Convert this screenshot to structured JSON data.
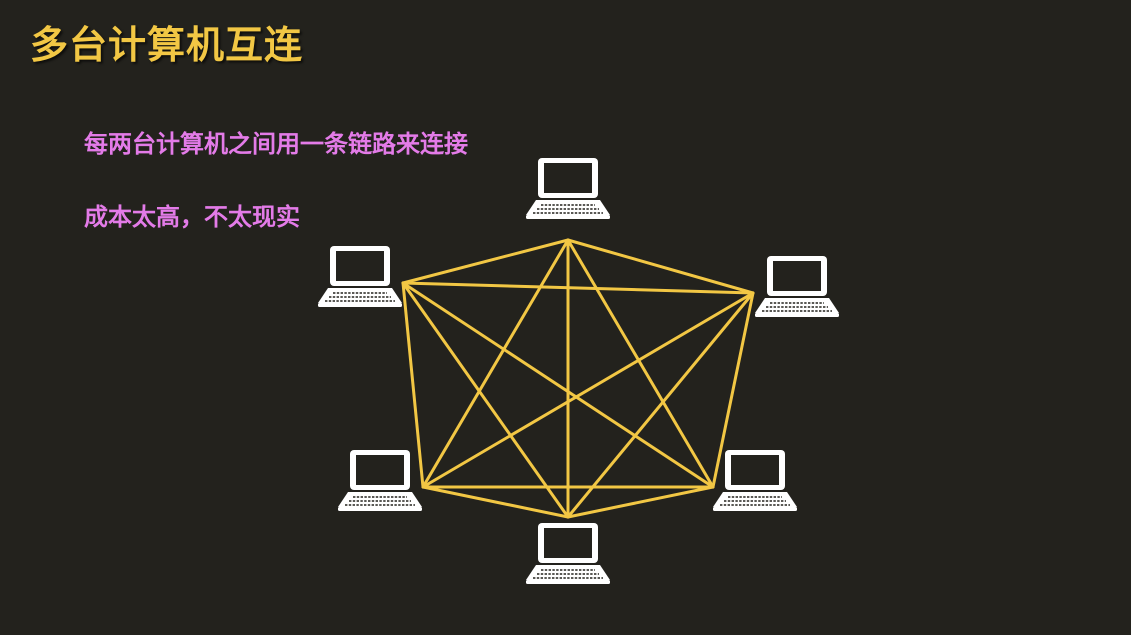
{
  "slide": {
    "title": "多台计算机互连",
    "bullets": [
      "每两台计算机之间用一条链路来连接",
      "成本太高，不太现实"
    ]
  },
  "diagram": {
    "node_icon": "laptop-icon",
    "link_color": "#f2c744",
    "icon_color": "#ffffff",
    "node_count": 6,
    "topology": "full-mesh"
  }
}
